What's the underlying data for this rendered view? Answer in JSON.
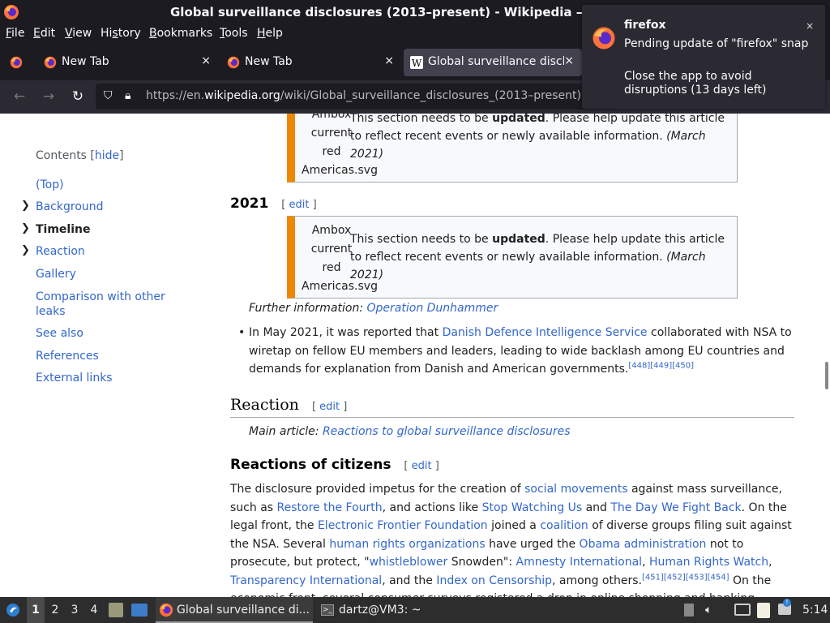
{
  "window": {
    "title": "Global surveillance disclosures (2013–present) - Wikipedia — Mozilla Firefox",
    "title_visible": "Global surveillance disclosures (2013–present) - Wikipedia — M"
  },
  "menubar": {
    "items": [
      {
        "label": "File",
        "accel": "F"
      },
      {
        "label": "Edit",
        "accel": "E"
      },
      {
        "label": "View",
        "accel": "V"
      },
      {
        "label": "History",
        "accel": "s"
      },
      {
        "label": "Bookmarks",
        "accel": "B"
      },
      {
        "label": "Tools",
        "accel": "T"
      },
      {
        "label": "Help",
        "accel": "H"
      }
    ]
  },
  "tabs": [
    {
      "label": "New Tab",
      "icon": "firefox-icon"
    },
    {
      "label": "New Tab",
      "icon": "firefox-icon"
    },
    {
      "label": "Global surveillance disclo",
      "icon": "wikipedia-icon",
      "active": true
    }
  ],
  "close_glyph": "×",
  "urlbar": {
    "prefix": "https://en.",
    "domain": "wikipedia.org",
    "path": "/wiki/Global_surveillance_disclosures_(2013–present)"
  },
  "notification": {
    "app": "firefox",
    "line1": "Pending update of \"firefox\" snap",
    "line2": "Close the app to avoid disruptions (13 days left)",
    "close": "×"
  },
  "toc": {
    "head": "Contents",
    "hide": "hide",
    "items": [
      {
        "label": "(Top)",
        "chevron": false
      },
      {
        "label": "Background",
        "chevron": true
      },
      {
        "label": "Timeline",
        "chevron": true,
        "current": true
      },
      {
        "label": "Reaction",
        "chevron": true
      },
      {
        "label": "Gallery",
        "chevron": false
      },
      {
        "label": "Comparison with other leaks",
        "chevron": false
      },
      {
        "label": "See also",
        "chevron": false
      },
      {
        "label": "References",
        "chevron": false
      },
      {
        "label": "External links",
        "chevron": false
      }
    ]
  },
  "ambox": {
    "img_alt_lines": [
      "Ambox",
      "current",
      "red"
    ],
    "img_alt_last": "Americas.svg",
    "msg_before": "This section needs to be ",
    "msg_bold": "updated",
    "msg_after": ". Please help update this article to reflect recent events or newly available information. ",
    "msg_date": "(March 2021)"
  },
  "sections": {
    "y2021": "2021",
    "edit": "edit",
    "further_label": "Further information: ",
    "further_link": "Operation Dunhammer",
    "bullet": {
      "t1": "In May 2021, it was reported that ",
      "l1": "Danish Defence Intelligence Service",
      "t2": " collaborated with NSA to wiretap on fellow EU members and leaders, leading to wide backlash among EU countries and demands for explanation from Danish and American governments.",
      "refs": "[448][449][450]"
    },
    "reaction": "Reaction",
    "main_label": "Main article: ",
    "main_link": "Reactions to global surveillance disclosures",
    "citizens": "Reactions of citizens",
    "para": {
      "t1": "The disclosure provided impetus for the creation of ",
      "l1": "social movements",
      "t2": " against mass surveillance, such as ",
      "l2": "Restore the Fourth",
      "t3": ", and actions like ",
      "l3": "Stop Watching Us",
      "t4": " and ",
      "l4": "The Day We Fight Back",
      "t5": ". On the legal front, the ",
      "l5": "Electronic Frontier Foundation",
      "t6": " joined a ",
      "l6": "coalition",
      "t7": " of diverse groups filing suit against the NSA. Several ",
      "l7": "human rights organizations",
      "t8": " have urged the ",
      "l8": "Obama administration",
      "t9": " not to prosecute, but protect, \"",
      "l9": "whistleblower",
      "t10": " Snowden\": ",
      "l10": "Amnesty International",
      "t11": ", ",
      "l11": "Human Rights Watch",
      "t12": ", ",
      "l12": "Transparency International",
      "t13": ", and the ",
      "l13": "Index on Censorship",
      "t14": ", among others.",
      "refs": "[451][452][453][454]",
      "t15": " On the economic front, several consumer surveys registered a drop in online shopping and banking"
    }
  },
  "taskbar": {
    "workspaces": [
      "1",
      "2",
      "3",
      "4"
    ],
    "task1": "Global surveillance di...",
    "task2": "dartz@VM3: ~",
    "clock": "5:14"
  },
  "colors": {
    "link": "#3366cc",
    "ambox_stripe": "#ee8800",
    "chrome_dark": "#1c1b22"
  }
}
